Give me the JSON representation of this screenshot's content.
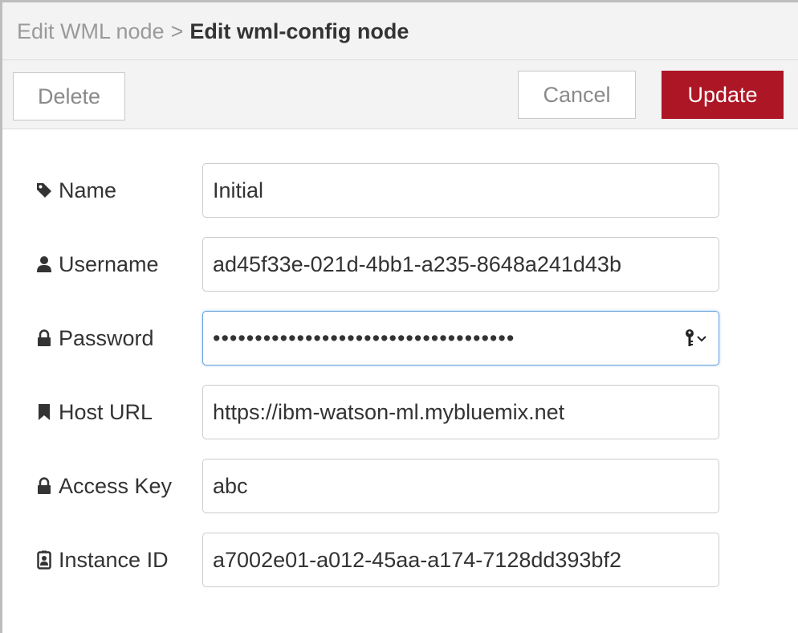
{
  "breadcrumb": {
    "parent": "Edit WML node",
    "separator": ">",
    "current": "Edit wml-config node"
  },
  "toolbar": {
    "delete_label": "Delete",
    "cancel_label": "Cancel",
    "update_label": "Update",
    "update_color": "#ad1625"
  },
  "form": {
    "name": {
      "label": "Name",
      "value": "Initial",
      "icon": "tag-icon"
    },
    "username": {
      "label": "Username",
      "value": "ad45f33e-021d-4bb1-a235-8648a241d43b",
      "icon": "user-icon"
    },
    "password": {
      "label": "Password",
      "value": "••••••••••••••••••••••••••••••••••••",
      "icon": "lock-icon",
      "toggle_icon": "key-dropdown-icon"
    },
    "host_url": {
      "label": "Host URL",
      "value": "https://ibm-watson-ml.mybluemix.net",
      "icon": "bookmark-icon"
    },
    "access_key": {
      "label": "Access Key",
      "value": "abc",
      "icon": "lock-icon"
    },
    "instance_id": {
      "label": "Instance ID",
      "value": "a7002e01-a012-45aa-a174-7128dd393bf2",
      "icon": "id-badge-icon"
    }
  }
}
